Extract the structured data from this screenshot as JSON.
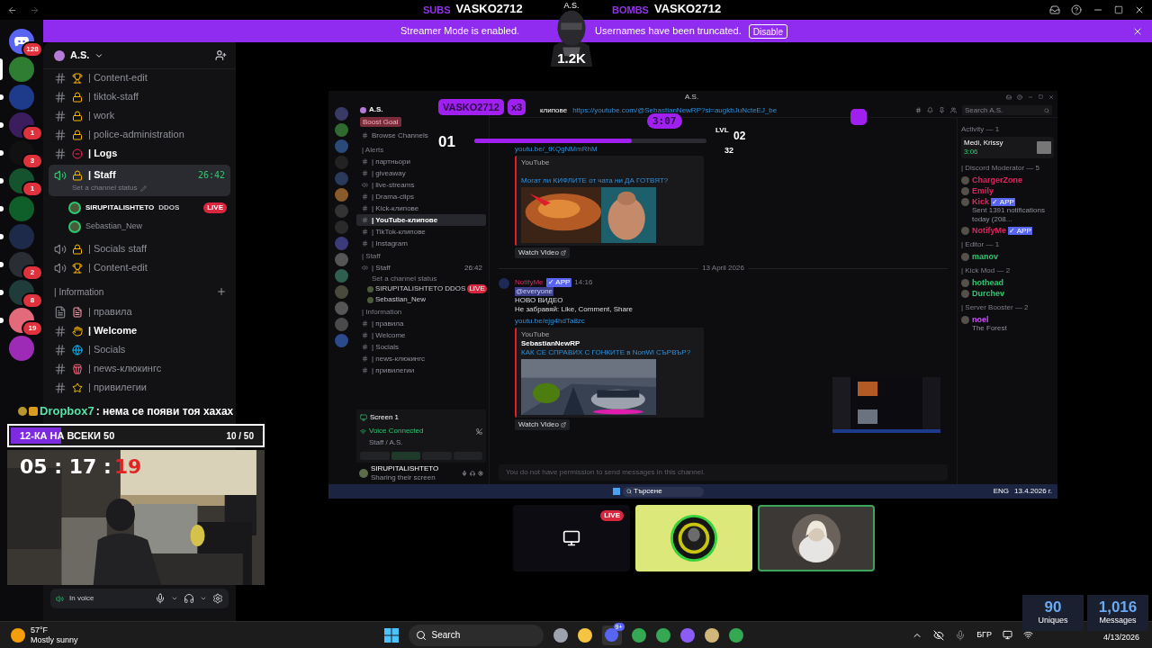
{
  "alerts": {
    "subs_label": "SUBS",
    "subs_name": "VASKO2712",
    "bombs_label": "BOMBS",
    "bombs_name": "VASKO2712",
    "avatar_title": "A.S.",
    "avatar_count": "1.2K"
  },
  "banner": {
    "text_before": "Streamer Mode is enabled.",
    "text_after": "Usernames have been truncated.",
    "button": "Disable"
  },
  "server_rail": [
    {
      "kind": "home",
      "badge": "128",
      "color": "#5865f2",
      "selected": false,
      "unread": false
    },
    {
      "kind": "server",
      "color": "#2f7d32",
      "selected": true
    },
    {
      "kind": "server",
      "color": "#1e3a8a",
      "selected": false,
      "unread": true
    },
    {
      "kind": "server",
      "badge": "1",
      "color": "#3b1d5e",
      "selected": false,
      "unread": true
    },
    {
      "kind": "server",
      "badge": "3",
      "color": "#111111",
      "selected": false,
      "unread": true
    },
    {
      "kind": "server",
      "badge": "1",
      "color": "#14532d",
      "selected": false,
      "unread": true
    },
    {
      "kind": "server",
      "color": "#0f5f2a",
      "selected": false,
      "unread": true
    },
    {
      "kind": "server",
      "color": "#1e2a4a",
      "selected": false,
      "unread": true
    },
    {
      "kind": "server",
      "badge": "2",
      "color": "#2a2d33",
      "selected": false,
      "unread": true
    },
    {
      "kind": "server",
      "badge": "8",
      "color": "#1f3b3a",
      "selected": false,
      "unread": true
    },
    {
      "kind": "server",
      "badge": "19",
      "color": "#e26a7a",
      "selected": false,
      "unread": true
    },
    {
      "kind": "server",
      "color": "#9d2bb5",
      "selected": false,
      "unread": false
    }
  ],
  "server": {
    "name": "A.S."
  },
  "channels": [
    {
      "kind": "text",
      "name": "| Content-edit",
      "unread": false
    },
    {
      "kind": "text",
      "name": "| tiktok-staff",
      "unread": false
    },
    {
      "kind": "text",
      "name": "| work",
      "unread": false
    },
    {
      "kind": "text",
      "name": "| police-administration",
      "unread": false
    },
    {
      "kind": "text",
      "name": "| Logs",
      "unread": true
    },
    {
      "kind": "voice",
      "name": "| Staff",
      "unread": true,
      "selected": true,
      "time": "26:42",
      "status": "Set a channel status",
      "members": [
        {
          "name": "SIRUPITALISHTETO",
          "activity": "DDOS",
          "live": "LIVE"
        },
        {
          "name": "Sebastian_New"
        }
      ]
    },
    {
      "kind": "voice",
      "name": "| Socials staff",
      "unread": false
    },
    {
      "kind": "voice",
      "name": "| Content-edit",
      "unread": false
    },
    {
      "kind": "category",
      "name": "| Information"
    },
    {
      "kind": "rules",
      "name": "| правила",
      "unread": false
    },
    {
      "kind": "text",
      "name": "| Welcome",
      "unread": true
    },
    {
      "kind": "text",
      "name": "| Socials",
      "unread": false
    },
    {
      "kind": "text",
      "name": "| news-клюкингс",
      "unread": false
    },
    {
      "kind": "text",
      "name": "| привилегии",
      "unread": false
    }
  ],
  "chat": {
    "user": "Dropbox7",
    "text": ": нема се появи тоя хахах"
  },
  "goal": {
    "title": "12-КА НА ВСЕКИ 50",
    "count": "10 / 50",
    "level": 0.2
  },
  "timer": {
    "time": "05 : 17 :",
    "seconds": "19"
  },
  "user_panel": {
    "status": "In voice"
  },
  "share": {
    "title": "A.S.",
    "server": "A.S.",
    "boost_goal": "Boost Goal",
    "browse": "Browse Channels",
    "channels": [
      {
        "kind": "category",
        "name": "| Alerts"
      },
      {
        "kind": "text",
        "name": "| партньори",
        "selected": false
      },
      {
        "kind": "text",
        "name": "| giveaway",
        "selected": false
      },
      {
        "kind": "voice",
        "name": "| live-streams",
        "selected": false
      },
      {
        "kind": "text",
        "name": "| Drama-clips",
        "selected": false
      },
      {
        "kind": "text",
        "name": "| Kick-клипове",
        "selected": false
      },
      {
        "kind": "text",
        "name": "| YouTube-клипове",
        "selected": true
      },
      {
        "kind": "text",
        "name": "| TikTok-клипове",
        "selected": false
      },
      {
        "kind": "text",
        "name": "| Instagram",
        "selected": false
      },
      {
        "kind": "category",
        "name": "| Staff"
      },
      {
        "kind": "voice",
        "name": "| Staff",
        "selected": false,
        "time": "26:42",
        "status": "Set a channel status",
        "members": [
          {
            "name": "SIRUPITALISHTETO",
            "activity": "DDOS",
            "live": "LIVE"
          },
          {
            "name": "Sebastian_New"
          }
        ]
      },
      {
        "kind": "category",
        "name": "| Information"
      },
      {
        "kind": "text",
        "name": "| правила",
        "selected": false
      },
      {
        "kind": "text",
        "name": "| Welcome",
        "selected": false
      },
      {
        "kind": "text",
        "name": "| Socials",
        "selected": false
      },
      {
        "kind": "text",
        "name": "| news-клюкингс",
        "selected": false
      },
      {
        "kind": "text",
        "name": "| привилегии",
        "selected": false
      }
    ],
    "voice_panel": {
      "stream": "Screen 1",
      "status": "Voice Connected",
      "location": "Staff / A.S."
    },
    "user": {
      "name": "SIRUPITALISHTETO",
      "status": "Sharing their screen"
    },
    "header": {
      "channel": "клипове",
      "topic": "https://youtube.com/@SebastianNewRP?si=augkbJuNcteEJ_be"
    },
    "search": "Search A.S.",
    "messages": [
      {
        "kind": "embed",
        "link": "youtu.be/_tKQgNMmRhM",
        "provider": "YouTube",
        "title": "Могат ли КИФЛИТЕ от чата ни ДА ГОТВЯТ?",
        "button": "Watch Video"
      },
      {
        "kind": "divider",
        "text": "13 April 2026"
      },
      {
        "kind": "post",
        "author": "NotifyMe",
        "tag": "✓ APP",
        "time": "14:16",
        "lines": [
          "@everyone",
          "НОВО ВИДЕО",
          "Не забравяй: Like, Comment, Share"
        ]
      },
      {
        "kind": "embed",
        "link": "youtu.be/ejg4hdTa8zc",
        "provider": "YouTube",
        "author": "SebastianNewRP",
        "title": "КАК СЕ СПРАВИХ С ГОНКИТЕ в NonWl СЪРВЪР?",
        "button": "Watch Video"
      }
    ],
    "composer_placeholder": "You do not have permission to send messages in this channel.",
    "members": [
      {
        "kind": "header",
        "text": "Activity — 1"
      },
      {
        "kind": "activity",
        "name": "Medi, Krissy",
        "time": "3:06"
      },
      {
        "kind": "header",
        "text": "| Discord Moderator — 5"
      },
      {
        "kind": "member",
        "name": "ChargerZone",
        "color": "#e0245e"
      },
      {
        "kind": "member",
        "name": "Emily",
        "color": "#e0245e"
      },
      {
        "kind": "member",
        "name": "Kick",
        "color": "#e0245e",
        "tag": "✓ APP",
        "sub": "Sent 1391 notifications today (208..."
      },
      {
        "kind": "member",
        "name": "NotifyMe",
        "color": "#e0245e",
        "tag": "✓ APP"
      },
      {
        "kind": "header",
        "text": "| Editor — 1"
      },
      {
        "kind": "member",
        "name": "manov",
        "color": "#2dc770"
      },
      {
        "kind": "header",
        "text": "| Kick Mod — 2"
      },
      {
        "kind": "member",
        "name": "hothead",
        "color": "#2dc770"
      },
      {
        "kind": "member",
        "name": "Durchev",
        "color": "#2dc770"
      },
      {
        "kind": "header",
        "text": "| Server Booster — 2"
      },
      {
        "kind": "member",
        "name": "noel",
        "color": "#d24dff",
        "sub": "The Forest"
      }
    ],
    "taskbar": {
      "search": "Търсене",
      "lang": "ENG",
      "date": "13.4.2026 г."
    },
    "overlay": {
      "streak_name": "VASKO2712",
      "streak_mult": "x3",
      "timer": "3:07",
      "level_from": "01",
      "level_value": "32",
      "level_label": "LVL",
      "level_to": "02",
      "level": 0.68
    }
  },
  "tiles": [
    {
      "kind": "screen",
      "live": "LIVE",
      "speaking": false
    },
    {
      "kind": "logo",
      "speaking": false
    },
    {
      "kind": "avatar",
      "speaking": true
    }
  ],
  "stats": [
    {
      "value": "90",
      "label": "Uniques"
    },
    {
      "value": "1,016",
      "label": "Messages"
    }
  ],
  "weather": {
    "temp": "57°F",
    "text": "Mostly sunny"
  },
  "taskbar": {
    "search": "Search",
    "discord_badge": "9+",
    "lang": "БГР",
    "date": "4/13/2026"
  }
}
